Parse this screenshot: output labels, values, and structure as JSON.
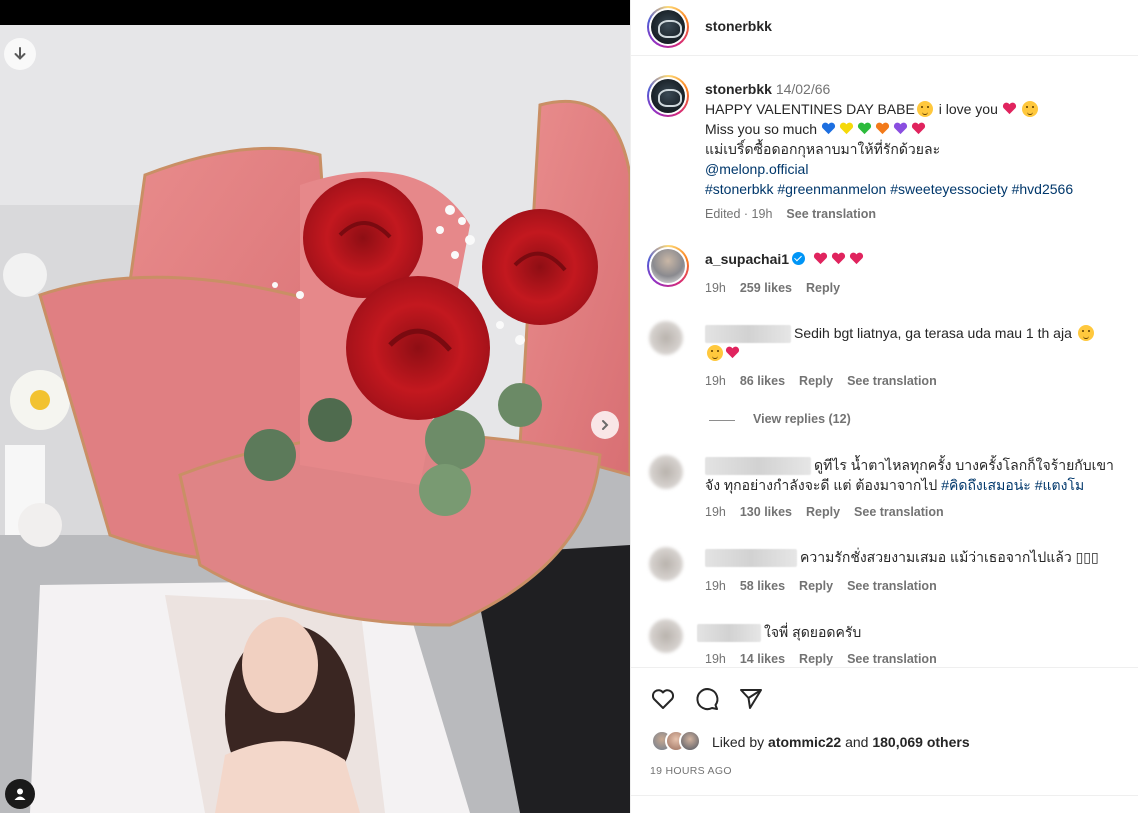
{
  "post": {
    "username": "stonerbkk",
    "caption": {
      "username": "stonerbkk",
      "date": "14/02/66",
      "line1_a": "HAPPY VALENTINES DAY BABE",
      "line1_b": "i love you",
      "line2": "Miss you so much",
      "line3": "แม่เบริ์ดซื้อดอกกุหลาบมาให้ที่รักด้วยละ",
      "mention": "@melonp.official",
      "hashtags": "#stonerbkk #greenmanmelon #sweeteyessociety #hvd2566",
      "edited": "Edited · 19h",
      "see_translation": "See translation"
    }
  },
  "comments": [
    {
      "username": "a_supachai1",
      "verified": true,
      "text": "",
      "time": "19h",
      "likes": "259 likes",
      "reply": "Reply"
    },
    {
      "text": "Sedih bgt liatnya, ga terasa uda mau 1 th aja",
      "time": "19h",
      "likes": "86 likes",
      "reply": "Reply",
      "see_translation": "See translation",
      "view_replies": "View replies (12)"
    },
    {
      "text_a": "ดูทีไร น้ำตาไหลทุกครั้ง บางครั้งโลกก็ใจร้ายกับเขา",
      "text_b": "จัง ทุกอย่างกำลังจะดี แต่ ต้องมาจากไป",
      "tags": "#คิดถึงเสมอน่ะ #แตงโม",
      "time": "19h",
      "likes": "130 likes",
      "reply": "Reply",
      "see_translation": "See translation"
    },
    {
      "text": "ความรักชั่งสวยงามเสมอ แม้ว่าเธอจากไปแล้ว ▯▯▯",
      "time": "19h",
      "likes": "58 likes",
      "reply": "Reply",
      "see_translation": "See translation"
    },
    {
      "text": "ใจพี่ สุดยอดครับ",
      "time": "19h",
      "likes": "14 likes",
      "reply": "Reply",
      "see_translation": "See translation"
    }
  ],
  "actions": {
    "liked_by_prefix": "Liked by",
    "liked_by_user": "atommic22",
    "liked_by_and": "and",
    "liked_by_count": "180,069 others",
    "time_ago": "19 HOURS AGO"
  },
  "icons": {
    "download": "download-icon",
    "next": "chevron-right-icon",
    "tag": "user-tag-icon",
    "like": "heart-icon",
    "comment": "comment-icon",
    "share": "send-icon"
  },
  "colors": {
    "link": "#00376b",
    "muted": "#737373",
    "verified": "#0095f6",
    "heart_red": "#e0245e"
  },
  "carousel": {
    "slides": 9,
    "active_index": 0
  }
}
